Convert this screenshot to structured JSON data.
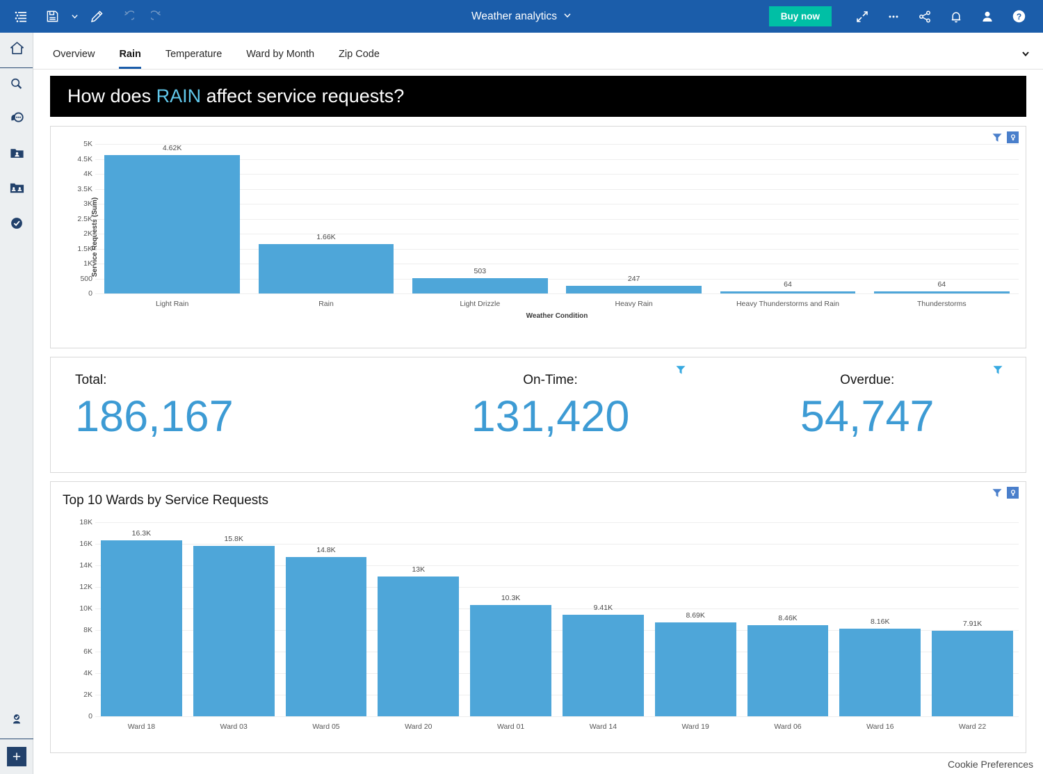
{
  "topbar": {
    "title": "Weather analytics",
    "buy_now_label": "Buy now",
    "icons_left": [
      "menu-list-icon",
      "save-icon",
      "save-dropdown-caret",
      "edit-pencil-icon",
      "undo-icon",
      "redo-icon"
    ],
    "icons_right": [
      "fullscreen-icon",
      "more-options-icon",
      "share-icon",
      "notifications-bell-icon",
      "user-account-icon",
      "help-icon"
    ],
    "accent_bg": "#1b5daa",
    "buy_now_bg": "#00bfa5"
  },
  "sidebar": {
    "items": [
      {
        "name": "home",
        "icon": "home-icon"
      },
      {
        "name": "search",
        "icon": "search-icon"
      },
      {
        "name": "conversation",
        "icon": "chat-bubble-icon"
      },
      {
        "name": "my-content",
        "icon": "folder-person-icon"
      },
      {
        "name": "shared-content",
        "icon": "folder-cards-icon"
      },
      {
        "name": "tasks",
        "icon": "check-circle-icon"
      }
    ],
    "bottom_items": [
      {
        "name": "account",
        "icon": "verified-user-icon"
      },
      {
        "name": "create-new",
        "icon": "plus-icon"
      }
    ]
  },
  "tabs": [
    {
      "label": "Overview",
      "active": false
    },
    {
      "label": "Rain",
      "active": true
    },
    {
      "label": "Temperature",
      "active": false
    },
    {
      "label": "Ward by Month",
      "active": false
    },
    {
      "label": "Zip Code",
      "active": false
    }
  ],
  "banner": {
    "prefix": "How does ",
    "highlight": "RAIN",
    "suffix": " affect service requests?",
    "highlight_color": "#61c7ea",
    "bg": "#000000"
  },
  "kpis": [
    {
      "label": "Total:",
      "value": "186,167",
      "has_filter": false
    },
    {
      "label": "On-Time:",
      "value": "131,420",
      "has_filter": true
    },
    {
      "label": "Overdue:",
      "value": "54,747",
      "has_filter": true
    }
  ],
  "card_tools": {
    "filter": "filter-funnel-icon",
    "key": "key-magnifier-icon"
  },
  "footer": {
    "cookie_preferences": "Cookie Preferences"
  },
  "chart_data": [
    {
      "type": "bar",
      "id": "weather-condition-chart",
      "title": "",
      "categories": [
        "Light Rain",
        "Rain",
        "Light Drizzle",
        "Heavy Rain",
        "Heavy Thunderstorms and Rain",
        "Thunderstorms"
      ],
      "values": [
        4620,
        1660,
        503,
        247,
        64,
        64
      ],
      "labels": [
        "4.62K",
        "1.66K",
        "503",
        "247",
        "64",
        "64"
      ],
      "xlabel": "Weather Condition",
      "ylabel": "Service Requests (Sum)",
      "ylim": [
        0,
        5000
      ],
      "yticks": [
        0,
        500,
        1000,
        1500,
        2000,
        2500,
        3000,
        3500,
        4000,
        4500,
        5000
      ],
      "ytick_labels": [
        "0",
        "500",
        "1K",
        "1.5K",
        "2K",
        "2.5K",
        "3K",
        "3.5K",
        "4K",
        "4.5K",
        "5K"
      ],
      "bar_color": "#4ea6d9",
      "grid": true,
      "legend": "none"
    },
    {
      "type": "bar",
      "id": "top-wards-chart",
      "title": "Top 10 Wards by Service Requests",
      "categories": [
        "Ward 18",
        "Ward 03",
        "Ward 05",
        "Ward 20",
        "Ward 01",
        "Ward 14",
        "Ward 19",
        "Ward 06",
        "Ward 16",
        "Ward 22"
      ],
      "values": [
        16300,
        15800,
        14800,
        13000,
        10300,
        9410,
        8690,
        8460,
        8160,
        7910
      ],
      "labels": [
        "16.3K",
        "15.8K",
        "14.8K",
        "13K",
        "10.3K",
        "9.41K",
        "8.69K",
        "8.46K",
        "8.16K",
        "7.91K"
      ],
      "xlabel": "",
      "ylabel": "",
      "ylim": [
        0,
        18000
      ],
      "yticks": [
        0,
        2000,
        4000,
        6000,
        8000,
        10000,
        12000,
        14000,
        16000,
        18000
      ],
      "ytick_labels": [
        "0",
        "2K",
        "4K",
        "6K",
        "8K",
        "10K",
        "12K",
        "14K",
        "16K",
        "18K"
      ],
      "bar_color": "#4ea6d9",
      "grid": true,
      "legend": "none"
    }
  ]
}
